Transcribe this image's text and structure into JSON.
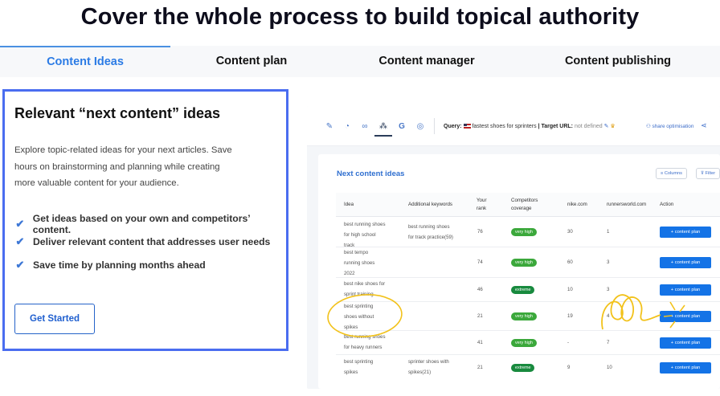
{
  "hero": {
    "title": "Cover the whole process to build topical authority"
  },
  "tabs": [
    {
      "label": "Content Ideas",
      "active": true
    },
    {
      "label": "Content plan",
      "active": false
    },
    {
      "label": "Content manager",
      "active": false
    },
    {
      "label": "Content publishing",
      "active": false
    }
  ],
  "card": {
    "title": "Relevant “next content” ideas",
    "description_lines": [
      "Explore topic-related ideas for your next articles. Save",
      "hours on brainstorming and planning while creating",
      "more valuable content for your audience."
    ],
    "features": [
      "Get ideas based on your own and competitors’ content.",
      "Deliver relevant content that addresses user needs",
      "Save time by planning months ahead"
    ],
    "cta_label": "Get Started"
  },
  "app": {
    "toolbar": {
      "icons": [
        "feather-icon",
        "pie-chart-icon",
        "link-icon",
        "network-icon",
        "google-icon",
        "chat-icon"
      ],
      "query_label": "Query:",
      "query_value": "fastest shoes for sprinters",
      "target_label": "| Target URL:",
      "target_value": "not defined",
      "share_label": "share optimisation"
    },
    "section_title": "Next content ideas",
    "columns_btn": "≡ Columns",
    "filter_btn": "⊽ Filter",
    "headers": [
      "Idea",
      "Additional keywords",
      "Your rank",
      "Competitors coverage",
      "nike.com",
      "runnersworld.com",
      "Action"
    ],
    "rows": [
      {
        "idea": [
          "best running shoes",
          "for high school",
          "track"
        ],
        "keywords": [
          "best running shoes",
          "for track practice(59)"
        ],
        "rank": "76",
        "coverage": "very high",
        "nike": "30",
        "rw": "1",
        "action": "+ content plan"
      },
      {
        "idea": [
          "best tempo",
          "running shoes",
          "2022"
        ],
        "keywords": [],
        "rank": "74",
        "coverage": "very high",
        "nike": "60",
        "rw": "3",
        "action": "+ content plan"
      },
      {
        "idea": [
          "best nike shoes for",
          "sprint training"
        ],
        "keywords": [],
        "rank": "46",
        "coverage": "extreme",
        "nike": "10",
        "rw": "3",
        "action": "+ content plan"
      },
      {
        "idea": [
          "best sprinting",
          "shoes without",
          "spikes"
        ],
        "keywords": [],
        "rank": "21",
        "coverage": "very high",
        "nike": "19",
        "rw": "4",
        "action": "+ content plan"
      },
      {
        "idea": [
          "best running shoes",
          "for heavy runners"
        ],
        "keywords": [],
        "rank": "41",
        "coverage": "very high",
        "nike": "-",
        "rw": "7",
        "action": "+ content plan"
      },
      {
        "idea": [
          "best sprinting",
          "spikes"
        ],
        "keywords": [
          "sprinter shoes with",
          "spikes(21)"
        ],
        "rank": "21",
        "coverage": "extreme",
        "nike": "9",
        "rw": "10",
        "action": "+ content plan"
      }
    ]
  },
  "colors": {
    "accent": "#2b7be5",
    "card_border": "#4a6df0",
    "action_button": "#1473e6",
    "pill_very_high": "#3ba83b",
    "pill_extreme": "#188a3e",
    "annotation": "#f2c21b"
  }
}
